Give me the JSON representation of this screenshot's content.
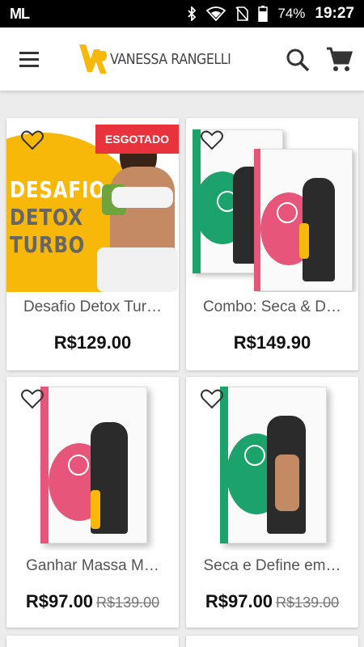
{
  "status_bar": {
    "carrier_logo": "ML",
    "battery": "74%",
    "time": "19:27"
  },
  "header": {
    "brand_name": "VANESSA RANGELLI",
    "menu_icon": "menu-icon",
    "search_icon": "search-icon",
    "cart_icon": "cart-icon"
  },
  "colors": {
    "brand_yellow": "#f7b80a",
    "sold_out_red": "#e8333c",
    "green": "#1ba36b",
    "pink": "#e8557a"
  },
  "products": [
    {
      "title": "Desafio Detox Tur…",
      "price": "R$129.00",
      "badge": "ESGOTADO",
      "cover_lines": [
        "DESAFIO",
        "DETOX",
        "TURBO"
      ]
    },
    {
      "title": "Combo: Seca & D…",
      "price": "R$149.90"
    },
    {
      "title": "Ganhar Massa M…",
      "price": "R$97.00",
      "old_price": "R$139.00"
    },
    {
      "title": "Seca e Define em…",
      "price": "R$97.00",
      "old_price": "R$139.00"
    }
  ]
}
